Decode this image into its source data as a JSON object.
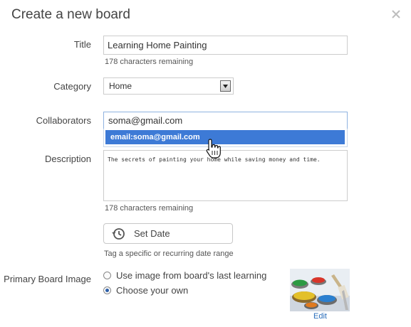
{
  "header": {
    "title": "Create a new board"
  },
  "fields": {
    "title_label": "Title",
    "title_value": "Learning Home Painting",
    "title_remaining": "178 characters remaining",
    "category_label": "Category",
    "category_value": "Home",
    "collaborators_label": "Collaborators",
    "collaborators_value": "soma@gmail.com",
    "collaborators_suggestion": "email:soma@gmail.com",
    "description_label": "Description",
    "description_value": "The secrets of painting your home while saving money and time.",
    "description_remaining": "178 characters remaining"
  },
  "date": {
    "button_label": "Set Date",
    "helper": "Tag a specific or recurring date range"
  },
  "image": {
    "label": "Primary Board Image",
    "options": [
      {
        "label": "Use image from board's last learning",
        "checked": false
      },
      {
        "label": "Choose your own",
        "checked": true
      }
    ],
    "edit_label": "Edit"
  },
  "icons": {
    "close": "close-icon",
    "dropdown": "chevron-down-icon",
    "history": "history-clock-icon",
    "cursor": "hand-pointer-icon"
  },
  "colors": {
    "suggestion_bg": "#3d7ad6",
    "link": "#2a6ebb"
  }
}
